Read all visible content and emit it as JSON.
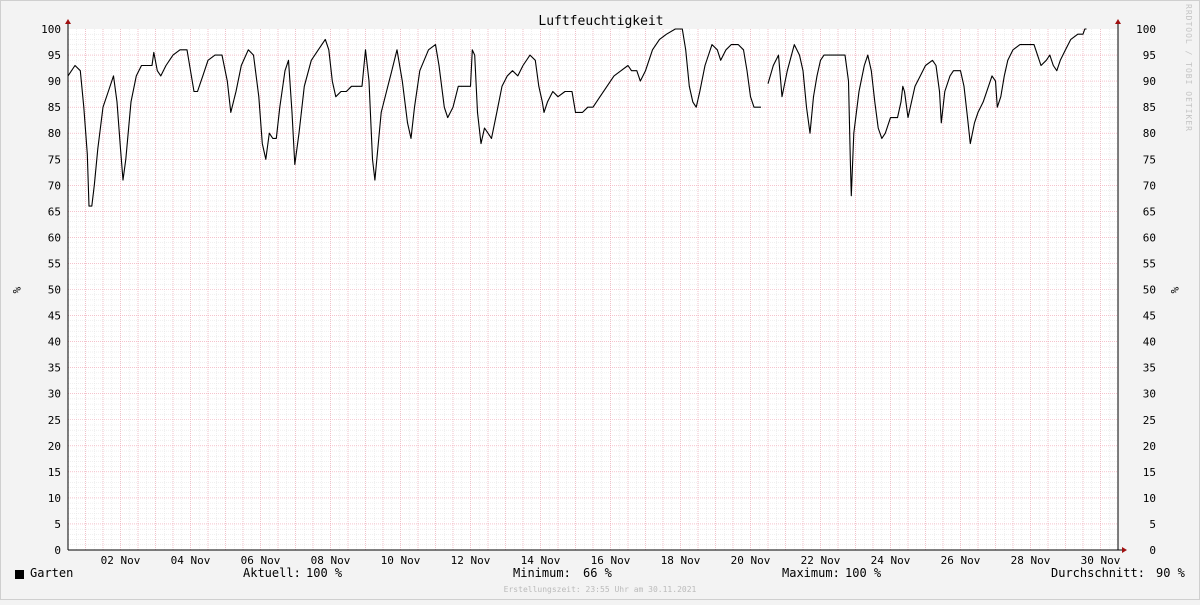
{
  "chart_data": {
    "type": "line",
    "title": "Luftfeuchtigkeit",
    "ylabel": "%",
    "ylim": [
      0,
      100
    ],
    "yticks": [
      0,
      5,
      10,
      15,
      20,
      25,
      30,
      35,
      40,
      45,
      50,
      55,
      60,
      65,
      70,
      75,
      80,
      85,
      90,
      95,
      100
    ],
    "xlim": [
      0,
      30
    ],
    "xticks": [
      {
        "x": 1.5,
        "label": "02 Nov"
      },
      {
        "x": 3.5,
        "label": "04 Nov"
      },
      {
        "x": 5.5,
        "label": "06 Nov"
      },
      {
        "x": 7.5,
        "label": "08 Nov"
      },
      {
        "x": 9.5,
        "label": "10 Nov"
      },
      {
        "x": 11.5,
        "label": "12 Nov"
      },
      {
        "x": 13.5,
        "label": "14 Nov"
      },
      {
        "x": 15.5,
        "label": "16 Nov"
      },
      {
        "x": 17.5,
        "label": "18 Nov"
      },
      {
        "x": 19.5,
        "label": "20 Nov"
      },
      {
        "x": 21.5,
        "label": "22 Nov"
      },
      {
        "x": 23.5,
        "label": "24 Nov"
      },
      {
        "x": 25.5,
        "label": "26 Nov"
      },
      {
        "x": 27.5,
        "label": "28 Nov"
      },
      {
        "x": 29.5,
        "label": "30 Nov"
      }
    ],
    "grid": true,
    "legend_position": "bottom-left",
    "line_color": "#000000",
    "grid_color": "#f0a0b0",
    "series": [
      {
        "name": "Garten",
        "segments": [
          [
            [
              0,
              91
            ],
            [
              0.2,
              93
            ],
            [
              0.35,
              92
            ],
            [
              0.45,
              85
            ],
            [
              0.55,
              76
            ],
            [
              0.6,
              66
            ],
            [
              0.68,
              66
            ],
            [
              0.75,
              70
            ],
            [
              0.85,
              77
            ],
            [
              1.0,
              85
            ],
            [
              1.15,
              88
            ],
            [
              1.3,
              91
            ],
            [
              1.4,
              86
            ],
            [
              1.5,
              77
            ],
            [
              1.57,
              71
            ],
            [
              1.65,
              75
            ],
            [
              1.8,
              86
            ],
            [
              1.95,
              91
            ],
            [
              2.1,
              93
            ],
            [
              2.4,
              93
            ],
            [
              2.45,
              95.5
            ],
            [
              2.55,
              92
            ],
            [
              2.65,
              91
            ],
            [
              2.8,
              93
            ],
            [
              3.0,
              95
            ],
            [
              3.2,
              96
            ],
            [
              3.4,
              96
            ],
            [
              3.5,
              92
            ],
            [
              3.6,
              88
            ],
            [
              3.7,
              88
            ],
            [
              3.85,
              91
            ],
            [
              4.0,
              94
            ],
            [
              4.2,
              95
            ],
            [
              4.4,
              95
            ],
            [
              4.55,
              90
            ],
            [
              4.65,
              84
            ],
            [
              4.8,
              88
            ],
            [
              4.95,
              93
            ],
            [
              5.15,
              96
            ],
            [
              5.3,
              95
            ],
            [
              5.45,
              87
            ],
            [
              5.55,
              78
            ],
            [
              5.65,
              75
            ],
            [
              5.75,
              80
            ],
            [
              5.85,
              79
            ],
            [
              5.95,
              79
            ],
            [
              6.05,
              85
            ],
            [
              6.2,
              92
            ],
            [
              6.3,
              94
            ],
            [
              6.4,
              84
            ],
            [
              6.48,
              74
            ],
            [
              6.6,
              80
            ],
            [
              6.75,
              89
            ],
            [
              6.95,
              94
            ],
            [
              7.15,
              96
            ],
            [
              7.35,
              98
            ],
            [
              7.45,
              96
            ],
            [
              7.55,
              90
            ],
            [
              7.65,
              87
            ],
            [
              7.8,
              88
            ],
            [
              7.95,
              88
            ],
            [
              8.1,
              89
            ],
            [
              8.4,
              89
            ],
            [
              8.5,
              96
            ],
            [
              8.6,
              90
            ],
            [
              8.7,
              75
            ],
            [
              8.77,
              71
            ],
            [
              8.85,
              77
            ],
            [
              8.95,
              84
            ],
            [
              9.1,
              88
            ],
            [
              9.25,
              92
            ],
            [
              9.4,
              96
            ],
            [
              9.55,
              90
            ],
            [
              9.7,
              82
            ],
            [
              9.8,
              79
            ],
            [
              9.9,
              85
            ],
            [
              10.05,
              92
            ],
            [
              10.3,
              96
            ],
            [
              10.5,
              97
            ],
            [
              10.6,
              93
            ],
            [
              10.75,
              85
            ],
            [
              10.85,
              83
            ],
            [
              11.0,
              85
            ],
            [
              11.15,
              89
            ],
            [
              11.4,
              89
            ],
            [
              11.5,
              89
            ],
            [
              11.55,
              96
            ],
            [
              11.62,
              95
            ],
            [
              11.7,
              84
            ],
            [
              11.8,
              78
            ],
            [
              11.9,
              81
            ],
            [
              12.0,
              80
            ],
            [
              12.1,
              79
            ],
            [
              12.25,
              84
            ],
            [
              12.4,
              89
            ],
            [
              12.55,
              91
            ],
            [
              12.7,
              92
            ],
            [
              12.85,
              91
            ],
            [
              13.0,
              93
            ],
            [
              13.2,
              95
            ],
            [
              13.35,
              94
            ],
            [
              13.45,
              89
            ],
            [
              13.55,
              86
            ],
            [
              13.6,
              84
            ],
            [
              13.7,
              86
            ],
            [
              13.85,
              88
            ],
            [
              14.0,
              87
            ],
            [
              14.2,
              88
            ],
            [
              14.4,
              88
            ],
            [
              14.5,
              84
            ],
            [
              14.7,
              84
            ],
            [
              14.85,
              85
            ],
            [
              15.0,
              85
            ],
            [
              15.2,
              87
            ],
            [
              15.4,
              89
            ],
            [
              15.6,
              91
            ],
            [
              15.8,
              92
            ],
            [
              16.0,
              93
            ],
            [
              16.1,
              92
            ],
            [
              16.25,
              92
            ],
            [
              16.35,
              90
            ],
            [
              16.5,
              92
            ],
            [
              16.7,
              96
            ],
            [
              16.9,
              98
            ],
            [
              17.1,
              99
            ],
            [
              17.35,
              100
            ],
            [
              17.55,
              100
            ],
            [
              17.65,
              96
            ],
            [
              17.75,
              89
            ],
            [
              17.85,
              86
            ],
            [
              17.95,
              85
            ],
            [
              18.05,
              88
            ],
            [
              18.2,
              93
            ],
            [
              18.4,
              97
            ],
            [
              18.55,
              96
            ],
            [
              18.65,
              94
            ],
            [
              18.8,
              96
            ],
            [
              18.95,
              97
            ],
            [
              19.15,
              97
            ],
            [
              19.3,
              96
            ],
            [
              19.4,
              92
            ],
            [
              19.5,
              87
            ],
            [
              19.6,
              85
            ],
            [
              19.7,
              85
            ],
            [
              19.8,
              85
            ]
          ],
          [
            [
              20.0,
              89.5
            ],
            [
              20.15,
              93
            ],
            [
              20.3,
              95
            ],
            [
              20.4,
              87
            ],
            [
              20.55,
              92
            ],
            [
              20.75,
              97
            ],
            [
              20.9,
              95
            ],
            [
              21.0,
              92
            ],
            [
              21.1,
              85
            ],
            [
              21.2,
              80
            ],
            [
              21.3,
              87
            ],
            [
              21.4,
              91
            ],
            [
              21.5,
              94
            ],
            [
              21.6,
              95
            ],
            [
              21.8,
              95
            ],
            [
              22.0,
              95
            ],
            [
              22.2,
              95
            ],
            [
              22.3,
              90
            ],
            [
              22.35,
              75
            ],
            [
              22.38,
              68
            ],
            [
              22.45,
              80
            ],
            [
              22.6,
              88
            ],
            [
              22.75,
              93
            ],
            [
              22.85,
              95
            ],
            [
              22.95,
              92
            ],
            [
              23.05,
              86
            ],
            [
              23.15,
              81
            ],
            [
              23.25,
              79
            ],
            [
              23.35,
              80
            ],
            [
              23.5,
              83
            ],
            [
              23.7,
              83
            ],
            [
              23.8,
              86
            ],
            [
              23.85,
              89
            ],
            [
              23.9,
              88
            ],
            [
              24.0,
              83
            ],
            [
              24.1,
              86
            ],
            [
              24.2,
              89
            ],
            [
              24.35,
              91
            ],
            [
              24.5,
              93
            ],
            [
              24.7,
              94
            ],
            [
              24.8,
              93
            ],
            [
              24.9,
              88
            ],
            [
              24.95,
              82
            ],
            [
              25.05,
              88
            ],
            [
              25.2,
              91
            ],
            [
              25.3,
              92
            ],
            [
              25.5,
              92
            ],
            [
              25.6,
              89
            ],
            [
              25.7,
              83
            ],
            [
              25.78,
              78
            ],
            [
              25.9,
              82
            ],
            [
              26.0,
              84
            ],
            [
              26.15,
              86
            ],
            [
              26.3,
              89
            ],
            [
              26.4,
              91
            ],
            [
              26.5,
              90
            ],
            [
              26.55,
              85
            ],
            [
              26.65,
              87
            ],
            [
              26.75,
              91
            ],
            [
              26.85,
              94
            ],
            [
              27.0,
              96
            ],
            [
              27.2,
              97
            ],
            [
              27.4,
              97
            ],
            [
              27.6,
              97
            ],
            [
              27.7,
              95
            ],
            [
              27.8,
              93
            ],
            [
              27.95,
              94
            ],
            [
              28.05,
              95
            ],
            [
              28.15,
              93
            ],
            [
              28.25,
              92
            ],
            [
              28.35,
              94
            ],
            [
              28.5,
              96
            ],
            [
              28.65,
              98
            ],
            [
              28.85,
              99
            ],
            [
              29.0,
              99
            ],
            [
              29.05,
              100
            ],
            [
              29.1,
              100
            ]
          ]
        ]
      }
    ]
  },
  "legend": {
    "series_name": "Garten",
    "current_label": "Aktuell:",
    "current_value": "100 %",
    "min_label": "Minimum:",
    "min_value": "66 %",
    "max_label": "Maximum:",
    "max_value": "100 %",
    "avg_label": "Durchschnitt:",
    "avg_value": "90 %"
  },
  "footer": "Erstellungszeit: 23:55 Uhr am 30.11.2021",
  "watermark": "RRDTOOL / TOBI OETIKER"
}
